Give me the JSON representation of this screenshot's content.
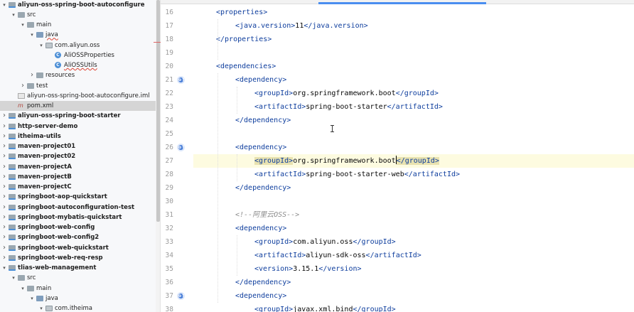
{
  "project_tree": {
    "rows": [
      {
        "label": "aliyun-oss-spring-boot-autoconfigure",
        "type": "module",
        "depth": 0,
        "expanded": true,
        "bold": true
      },
      {
        "label": "src",
        "type": "folder",
        "depth": 1,
        "expanded": true
      },
      {
        "label": "main",
        "type": "folder",
        "depth": 2,
        "expanded": true
      },
      {
        "label": "java",
        "type": "source-folder",
        "depth": 3,
        "expanded": true,
        "error": true
      },
      {
        "label": "com.aliyun.oss",
        "type": "package",
        "depth": 4,
        "expanded": true
      },
      {
        "label": "AliOSSProperties",
        "type": "class",
        "depth": 5
      },
      {
        "label": "AliOSSUtils",
        "type": "class",
        "depth": 5,
        "error": true
      },
      {
        "label": "resources",
        "type": "folder",
        "depth": 3,
        "expanded": false
      },
      {
        "label": "test",
        "type": "folder",
        "depth": 2,
        "expanded": false
      },
      {
        "label": "aliyun-oss-spring-boot-autoconfigure.iml",
        "type": "iml",
        "depth": 1
      },
      {
        "label": "pom.xml",
        "type": "maven",
        "depth": 1,
        "selected": true
      },
      {
        "label": "aliyun-oss-spring-boot-starter",
        "type": "module",
        "depth": 0,
        "expanded": false,
        "bold": true
      },
      {
        "label": "http-server-demo",
        "type": "module",
        "depth": 0,
        "expanded": false,
        "bold": true
      },
      {
        "label": "itheima-utils",
        "type": "module",
        "depth": 0,
        "expanded": false,
        "bold": true
      },
      {
        "label": "maven-project01",
        "type": "module",
        "depth": 0,
        "expanded": false,
        "bold": true
      },
      {
        "label": "maven-project02",
        "type": "module",
        "depth": 0,
        "expanded": false,
        "bold": true
      },
      {
        "label": "maven-projectA",
        "type": "module",
        "depth": 0,
        "expanded": false,
        "bold": true
      },
      {
        "label": "maven-projectB",
        "type": "module",
        "depth": 0,
        "expanded": false,
        "bold": true
      },
      {
        "label": "maven-projectC",
        "type": "module",
        "depth": 0,
        "expanded": false,
        "bold": true
      },
      {
        "label": "springboot-aop-quickstart",
        "type": "module",
        "depth": 0,
        "expanded": false,
        "bold": true
      },
      {
        "label": "springboot-autoconfiguration-test",
        "type": "module",
        "depth": 0,
        "expanded": false,
        "bold": true
      },
      {
        "label": "springboot-mybatis-quickstart",
        "type": "module",
        "depth": 0,
        "expanded": false,
        "bold": true
      },
      {
        "label": "springboot-web-config",
        "type": "module",
        "depth": 0,
        "expanded": false,
        "bold": true
      },
      {
        "label": "springboot-web-config2",
        "type": "module",
        "depth": 0,
        "expanded": false,
        "bold": true
      },
      {
        "label": "springboot-web-quickstart",
        "type": "module",
        "depth": 0,
        "expanded": false,
        "bold": true
      },
      {
        "label": "springboot-web-req-resp",
        "type": "module",
        "depth": 0,
        "expanded": false,
        "bold": true
      },
      {
        "label": "tlias-web-management",
        "type": "module",
        "depth": 0,
        "expanded": true,
        "bold": true
      },
      {
        "label": "src",
        "type": "folder",
        "depth": 1,
        "expanded": true
      },
      {
        "label": "main",
        "type": "folder",
        "depth": 2,
        "expanded": true
      },
      {
        "label": "java",
        "type": "source-folder",
        "depth": 3,
        "expanded": true
      },
      {
        "label": "com.itheima",
        "type": "package",
        "depth": 4,
        "expanded": true
      }
    ]
  },
  "editor": {
    "lines": [
      {
        "n": "16",
        "indent": 1,
        "parts": [
          [
            "tag",
            "<properties>"
          ]
        ]
      },
      {
        "n": "17",
        "indent": 2,
        "parts": [
          [
            "tag",
            "<java.version>"
          ],
          [
            "text",
            "11"
          ],
          [
            "tag",
            "</java.version>"
          ]
        ]
      },
      {
        "n": "18",
        "indent": 1,
        "parts": [
          [
            "tag",
            "</properties>"
          ]
        ]
      },
      {
        "n": "19",
        "indent": 0,
        "parts": []
      },
      {
        "n": "20",
        "indent": 1,
        "parts": [
          [
            "tag",
            "<dependencies>"
          ]
        ]
      },
      {
        "n": "21",
        "indent": 2,
        "marker": true,
        "parts": [
          [
            "tag",
            "<dependency>"
          ]
        ]
      },
      {
        "n": "22",
        "indent": 3,
        "parts": [
          [
            "tag",
            "<groupId>"
          ],
          [
            "text",
            "org.springframework.boot"
          ],
          [
            "tag",
            "</groupId>"
          ]
        ]
      },
      {
        "n": "23",
        "indent": 3,
        "parts": [
          [
            "tag",
            "<artifactId>"
          ],
          [
            "text",
            "spring-boot-starter"
          ],
          [
            "tag",
            "</artifactId>"
          ]
        ]
      },
      {
        "n": "24",
        "indent": 2,
        "parts": [
          [
            "tag",
            "</dependency>"
          ]
        ]
      },
      {
        "n": "25",
        "indent": 0,
        "parts": []
      },
      {
        "n": "26",
        "indent": 2,
        "marker": true,
        "parts": [
          [
            "tag",
            "<dependency>"
          ]
        ]
      },
      {
        "n": "27",
        "indent": 3,
        "current": true,
        "parts": [
          [
            "tag-hl",
            "<groupId>"
          ],
          [
            "text",
            "org.springframework.boot"
          ],
          [
            "caret",
            ""
          ],
          [
            "tag-hl",
            "</groupId>"
          ]
        ]
      },
      {
        "n": "28",
        "indent": 3,
        "parts": [
          [
            "tag",
            "<artifactId>"
          ],
          [
            "text",
            "spring-boot-starter-web"
          ],
          [
            "tag",
            "</artifactId>"
          ]
        ]
      },
      {
        "n": "29",
        "indent": 2,
        "parts": [
          [
            "tag",
            "</dependency>"
          ]
        ]
      },
      {
        "n": "30",
        "indent": 0,
        "parts": []
      },
      {
        "n": "31",
        "indent": 2,
        "parts": [
          [
            "comment",
            "<!--阿里云OSS-->"
          ]
        ]
      },
      {
        "n": "32",
        "indent": 2,
        "parts": [
          [
            "tag",
            "<dependency>"
          ]
        ]
      },
      {
        "n": "33",
        "indent": 3,
        "parts": [
          [
            "tag",
            "<groupId>"
          ],
          [
            "text",
            "com.aliyun.oss"
          ],
          [
            "tag",
            "</groupId>"
          ]
        ]
      },
      {
        "n": "34",
        "indent": 3,
        "parts": [
          [
            "tag",
            "<artifactId>"
          ],
          [
            "text",
            "aliyun-sdk-oss"
          ],
          [
            "tag",
            "</artifactId>"
          ]
        ]
      },
      {
        "n": "35",
        "indent": 3,
        "parts": [
          [
            "tag",
            "<version>"
          ],
          [
            "text",
            "3.15.1"
          ],
          [
            "tag",
            "</version>"
          ]
        ]
      },
      {
        "n": "36",
        "indent": 2,
        "parts": [
          [
            "tag",
            "</dependency>"
          ]
        ]
      },
      {
        "n": "37",
        "indent": 2,
        "marker": true,
        "parts": [
          [
            "tag",
            "<dependency>"
          ]
        ]
      },
      {
        "n": "38",
        "indent": 3,
        "parts": [
          [
            "tag",
            "<groupId>"
          ],
          [
            "text",
            "javax.xml.bind"
          ],
          [
            "tag",
            "</groupId>"
          ]
        ]
      }
    ],
    "marker_glyph": "o↑"
  },
  "colors": {
    "tag": "#0d3d9d",
    "text": "#080808",
    "comment": "#8c8c8c",
    "current_line": "#fdfbe0",
    "selection": "#d5d5d5",
    "accent": "#4a8ef0"
  }
}
